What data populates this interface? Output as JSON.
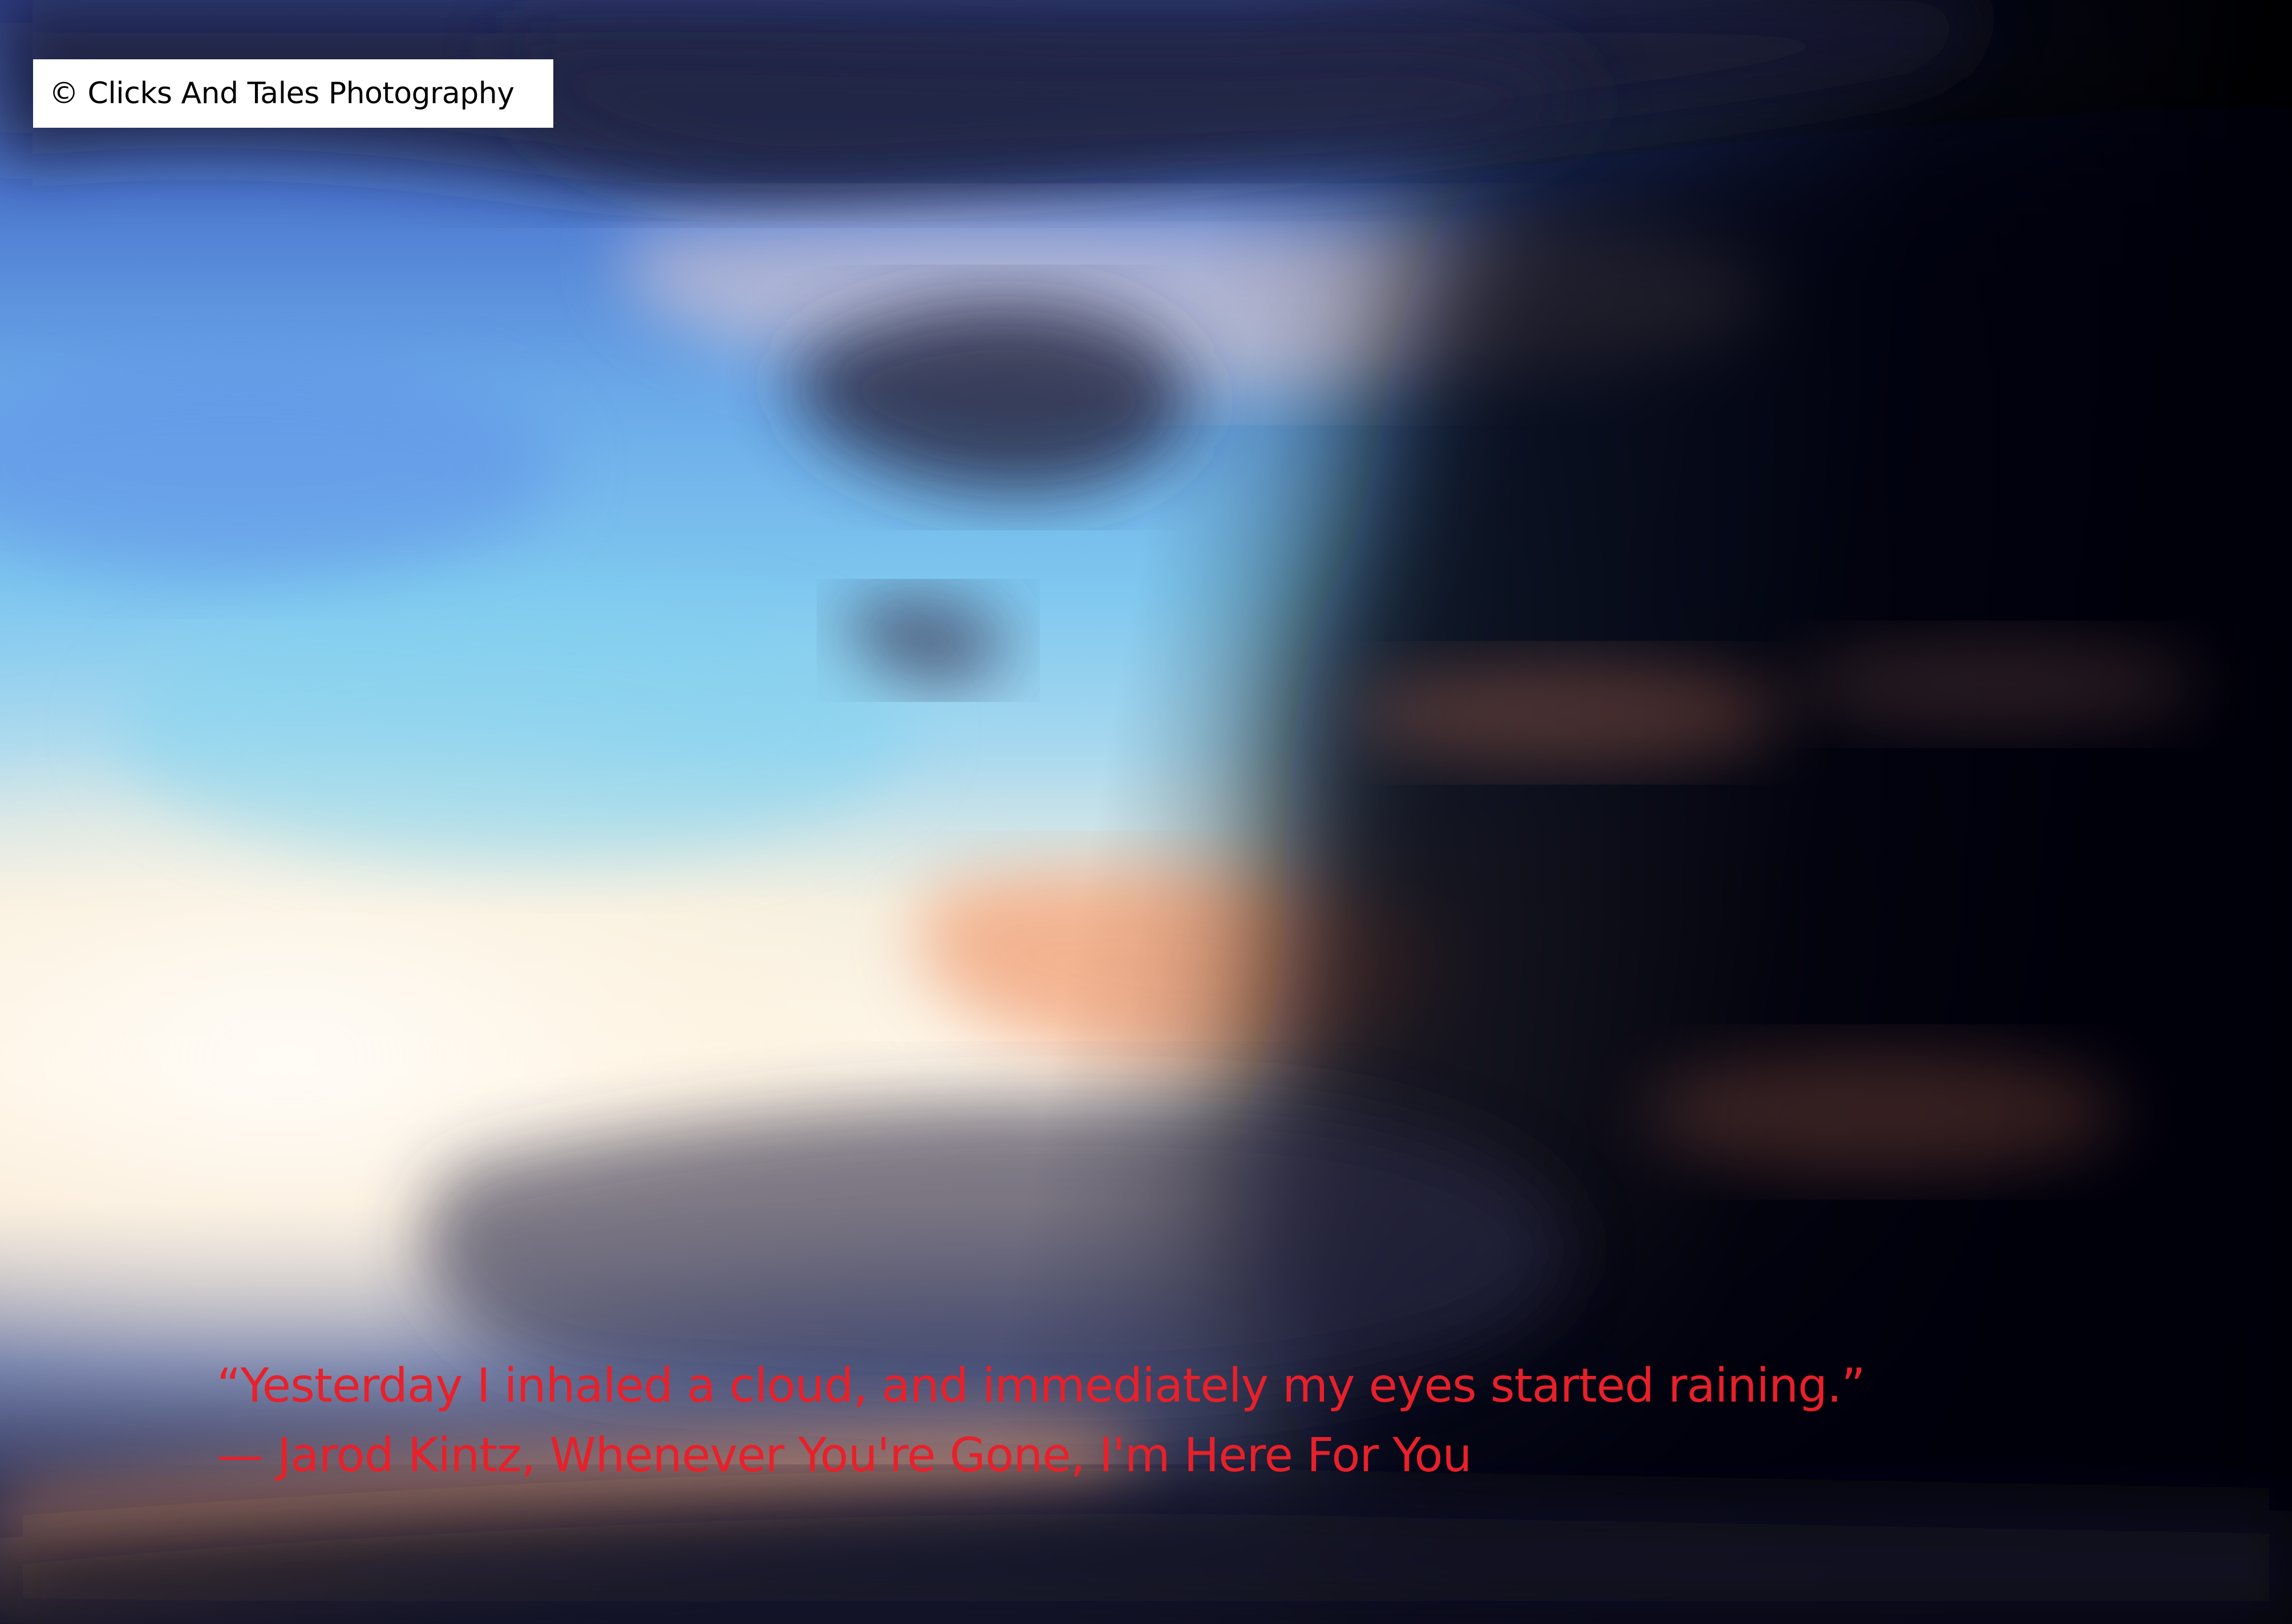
{
  "watermark": {
    "text": "© Clicks And Tales Photography",
    "box_color": "#ffffff",
    "text_color": "#000000"
  },
  "quote": {
    "line1": "“Yesterday I inhaled a cloud, and immediately my eyes started raining.”",
    "line2": "— Jarod Kintz, Whenever You're Gone, I'm Here For You",
    "color": "#e8202a"
  },
  "scene": {
    "subject": "sunset-clouds",
    "colors": {
      "blue_sky": "#7ec7ef",
      "bright_glow": "#fff7ea",
      "orange_glow": "#f08a5a",
      "dark_cloud": "#050510"
    }
  }
}
